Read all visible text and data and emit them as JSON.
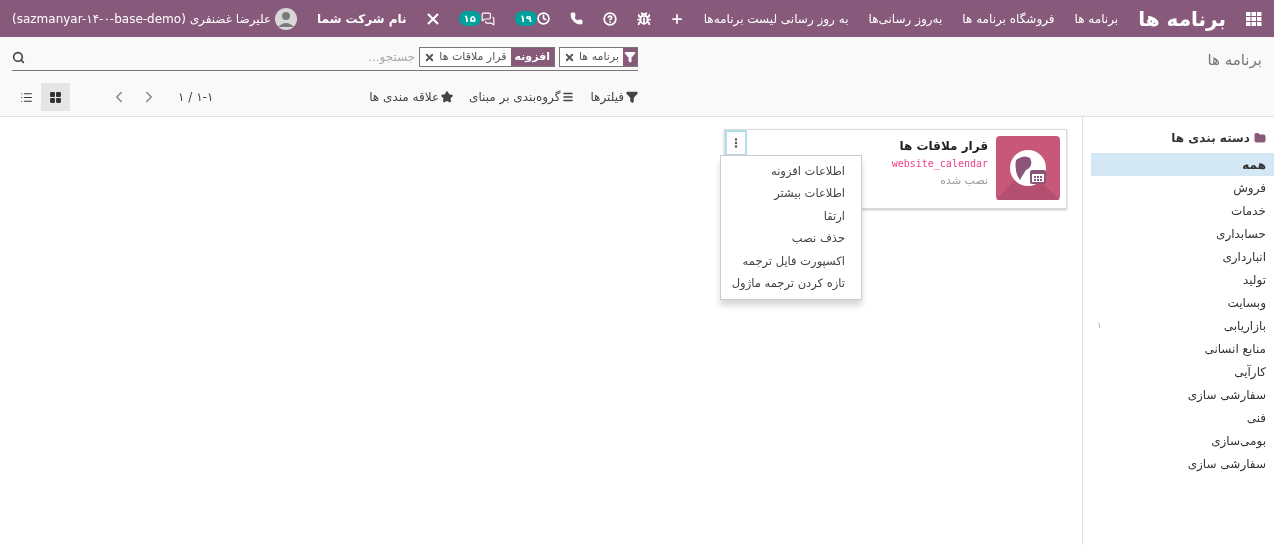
{
  "navbar": {
    "app_title": "برنامه ها",
    "menu": [
      "برنامه ها",
      "فروشگاه برنامه ها",
      "به‌روز رسانی‌ها",
      "به روز رسانی لیست برنامه‌ها"
    ],
    "activity_count": "۱۹",
    "message_count": "۱۵",
    "company": "نام شرکت شما",
    "user": "علیرضا غضنفری (sazmanyar-۱۴-۰-base-demo)"
  },
  "breadcrumb": "برنامه ها",
  "search": {
    "placeholder": "جستجو...",
    "facets": [
      {
        "kind": "filter",
        "value": "برنامه ها"
      },
      {
        "kind": "field",
        "field": "افزونه",
        "value": "قرار ملاقات ها"
      }
    ]
  },
  "actions": [
    "فیلترها",
    "گروه‌بندی بر مبنای",
    "علاقه مندی ها"
  ],
  "pager": "۱-۱ / ۱",
  "views": [
    {
      "kind": "kanban",
      "selected": true
    },
    {
      "kind": "list",
      "selected": false
    }
  ],
  "sidebar": {
    "title": "دسته بندی ها",
    "items": [
      {
        "label": "همه",
        "selected": true
      },
      {
        "label": "فروش",
        "selected": false
      },
      {
        "label": "خدمات",
        "selected": false
      },
      {
        "label": "حسابداری",
        "selected": false
      },
      {
        "label": "انبارداری",
        "selected": false
      },
      {
        "label": "تولید",
        "selected": false
      },
      {
        "label": "وبسایت",
        "selected": false
      },
      {
        "label": "بازاریابی",
        "selected": false,
        "count": "۱"
      },
      {
        "label": "منابع انسانی",
        "selected": false
      },
      {
        "label": "کارآیی",
        "selected": false
      },
      {
        "label": "سفارشی سازی",
        "selected": false
      },
      {
        "label": "فنی",
        "selected": false
      },
      {
        "label": "بومی‌سازی",
        "selected": false
      },
      {
        "label": "سفارشی سازی",
        "selected": false
      }
    ]
  },
  "cards": [
    {
      "name": "قرار ملاقات ها",
      "technical_name": "website_calendar",
      "status": "نصب شده",
      "menu_open": true,
      "menu": [
        "اطلاعات افزونه",
        "اطلاعات بیشتر",
        "ارتقا",
        "حذف نصب",
        "اکسپورت فایل ترجمه",
        "تازه کردن ترجمه ماژول"
      ]
    }
  ]
}
